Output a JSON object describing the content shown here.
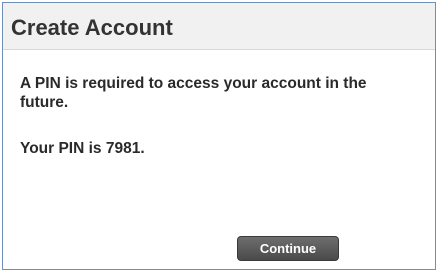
{
  "dialog": {
    "title": "Create Account",
    "message": "A PIN is required to access your account in the future.",
    "pin_text": "Your PIN is 7981.",
    "continue_label": "Continue"
  }
}
